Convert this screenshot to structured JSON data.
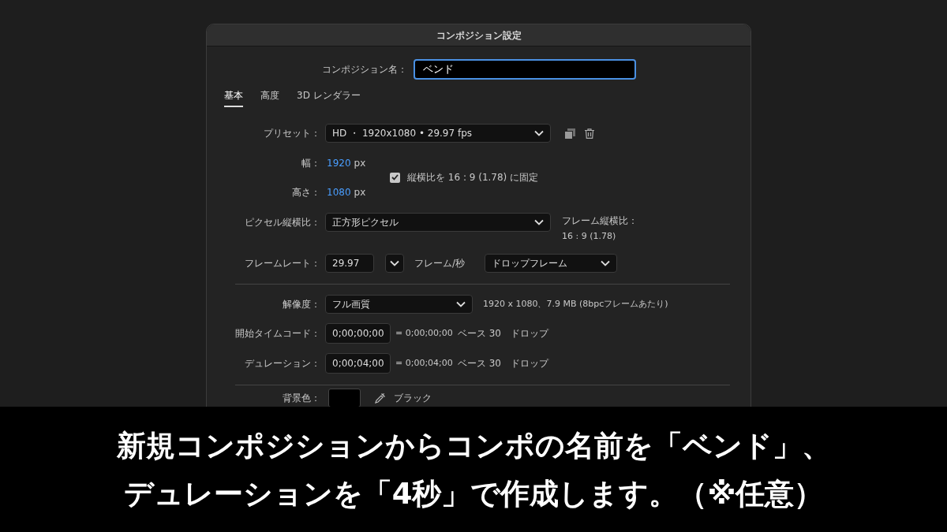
{
  "dialog": {
    "title": "コンポジション設定",
    "name_field": {
      "label": "コンポジション名：",
      "value": "ベンド"
    },
    "tabs": [
      {
        "label": "基本",
        "selected": true
      },
      {
        "label": "高度",
        "selected": false
      },
      {
        "label": "3D レンダラー",
        "selected": false
      }
    ],
    "preset": {
      "label": "プリセット：",
      "value": "HD ・ 1920x1080 • 29.97 fps"
    },
    "width": {
      "label": "幅：",
      "value": "1920",
      "unit": "px"
    },
    "lock_aspect": {
      "label": "縦横比を 16 : 9 (1.78) に固定",
      "checked": true
    },
    "height": {
      "label": "高さ：",
      "value": "1080",
      "unit": "px"
    },
    "pixel_aspect": {
      "label": "ピクセル縦横比：",
      "value": "正方形ピクセル"
    },
    "frame_aspect": {
      "label": "フレーム縦横比：",
      "value": "16 : 9 (1.78)"
    },
    "frame_rate": {
      "label": "フレームレート：",
      "value": "29.97",
      "unit": "フレーム/秒",
      "mode": "ドロップフレーム"
    },
    "resolution": {
      "label": "解像度：",
      "value": "フル画質",
      "info": "1920 x 1080、7.9 MB (8bpcフレームあたり)"
    },
    "timecodes": [
      {
        "label": "開始タイムコード：",
        "value": "0;00;00;00",
        "equals": "= 0;00;00;00",
        "base": "ベース 30",
        "mode": "ドロップ"
      },
      {
        "label": "デュレーション：",
        "value": "0;00;04;00",
        "equals": "= 0;00;04;00",
        "base": "ベース 30",
        "mode": "ドロップ"
      }
    ],
    "background": {
      "label": "背景色：",
      "color_name": "ブラック"
    }
  },
  "caption": [
    "新規コンポジションからコンポの名前を「ベンド」、",
    "デュレーションを「4秒」で作成します。（※任意）"
  ]
}
